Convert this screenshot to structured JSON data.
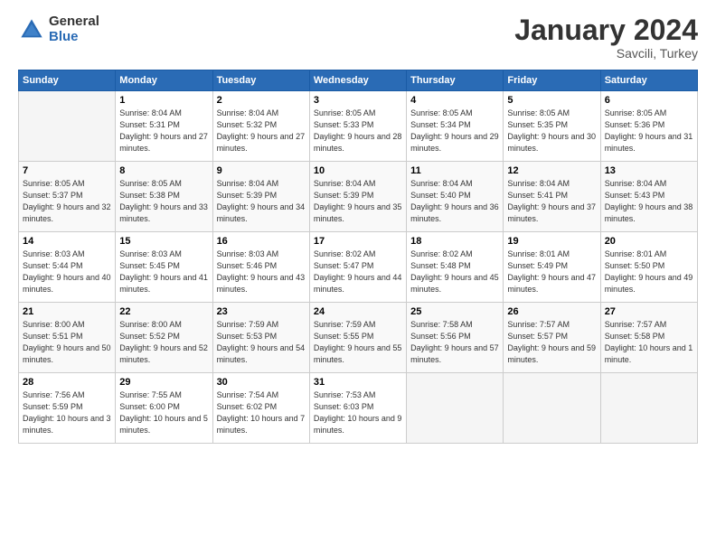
{
  "logo": {
    "general": "General",
    "blue": "Blue"
  },
  "header": {
    "month": "January 2024",
    "location": "Savcili, Turkey"
  },
  "weekdays": [
    "Sunday",
    "Monday",
    "Tuesday",
    "Wednesday",
    "Thursday",
    "Friday",
    "Saturday"
  ],
  "weeks": [
    [
      {
        "day": "",
        "empty": true
      },
      {
        "day": "1",
        "sunrise": "Sunrise: 8:04 AM",
        "sunset": "Sunset: 5:31 PM",
        "daylight": "Daylight: 9 hours and 27 minutes."
      },
      {
        "day": "2",
        "sunrise": "Sunrise: 8:04 AM",
        "sunset": "Sunset: 5:32 PM",
        "daylight": "Daylight: 9 hours and 27 minutes."
      },
      {
        "day": "3",
        "sunrise": "Sunrise: 8:05 AM",
        "sunset": "Sunset: 5:33 PM",
        "daylight": "Daylight: 9 hours and 28 minutes."
      },
      {
        "day": "4",
        "sunrise": "Sunrise: 8:05 AM",
        "sunset": "Sunset: 5:34 PM",
        "daylight": "Daylight: 9 hours and 29 minutes."
      },
      {
        "day": "5",
        "sunrise": "Sunrise: 8:05 AM",
        "sunset": "Sunset: 5:35 PM",
        "daylight": "Daylight: 9 hours and 30 minutes."
      },
      {
        "day": "6",
        "sunrise": "Sunrise: 8:05 AM",
        "sunset": "Sunset: 5:36 PM",
        "daylight": "Daylight: 9 hours and 31 minutes."
      }
    ],
    [
      {
        "day": "7",
        "sunrise": "Sunrise: 8:05 AM",
        "sunset": "Sunset: 5:37 PM",
        "daylight": "Daylight: 9 hours and 32 minutes."
      },
      {
        "day": "8",
        "sunrise": "Sunrise: 8:05 AM",
        "sunset": "Sunset: 5:38 PM",
        "daylight": "Daylight: 9 hours and 33 minutes."
      },
      {
        "day": "9",
        "sunrise": "Sunrise: 8:04 AM",
        "sunset": "Sunset: 5:39 PM",
        "daylight": "Daylight: 9 hours and 34 minutes."
      },
      {
        "day": "10",
        "sunrise": "Sunrise: 8:04 AM",
        "sunset": "Sunset: 5:39 PM",
        "daylight": "Daylight: 9 hours and 35 minutes."
      },
      {
        "day": "11",
        "sunrise": "Sunrise: 8:04 AM",
        "sunset": "Sunset: 5:40 PM",
        "daylight": "Daylight: 9 hours and 36 minutes."
      },
      {
        "day": "12",
        "sunrise": "Sunrise: 8:04 AM",
        "sunset": "Sunset: 5:41 PM",
        "daylight": "Daylight: 9 hours and 37 minutes."
      },
      {
        "day": "13",
        "sunrise": "Sunrise: 8:04 AM",
        "sunset": "Sunset: 5:43 PM",
        "daylight": "Daylight: 9 hours and 38 minutes."
      }
    ],
    [
      {
        "day": "14",
        "sunrise": "Sunrise: 8:03 AM",
        "sunset": "Sunset: 5:44 PM",
        "daylight": "Daylight: 9 hours and 40 minutes."
      },
      {
        "day": "15",
        "sunrise": "Sunrise: 8:03 AM",
        "sunset": "Sunset: 5:45 PM",
        "daylight": "Daylight: 9 hours and 41 minutes."
      },
      {
        "day": "16",
        "sunrise": "Sunrise: 8:03 AM",
        "sunset": "Sunset: 5:46 PM",
        "daylight": "Daylight: 9 hours and 43 minutes."
      },
      {
        "day": "17",
        "sunrise": "Sunrise: 8:02 AM",
        "sunset": "Sunset: 5:47 PM",
        "daylight": "Daylight: 9 hours and 44 minutes."
      },
      {
        "day": "18",
        "sunrise": "Sunrise: 8:02 AM",
        "sunset": "Sunset: 5:48 PM",
        "daylight": "Daylight: 9 hours and 45 minutes."
      },
      {
        "day": "19",
        "sunrise": "Sunrise: 8:01 AM",
        "sunset": "Sunset: 5:49 PM",
        "daylight": "Daylight: 9 hours and 47 minutes."
      },
      {
        "day": "20",
        "sunrise": "Sunrise: 8:01 AM",
        "sunset": "Sunset: 5:50 PM",
        "daylight": "Daylight: 9 hours and 49 minutes."
      }
    ],
    [
      {
        "day": "21",
        "sunrise": "Sunrise: 8:00 AM",
        "sunset": "Sunset: 5:51 PM",
        "daylight": "Daylight: 9 hours and 50 minutes."
      },
      {
        "day": "22",
        "sunrise": "Sunrise: 8:00 AM",
        "sunset": "Sunset: 5:52 PM",
        "daylight": "Daylight: 9 hours and 52 minutes."
      },
      {
        "day": "23",
        "sunrise": "Sunrise: 7:59 AM",
        "sunset": "Sunset: 5:53 PM",
        "daylight": "Daylight: 9 hours and 54 minutes."
      },
      {
        "day": "24",
        "sunrise": "Sunrise: 7:59 AM",
        "sunset": "Sunset: 5:55 PM",
        "daylight": "Daylight: 9 hours and 55 minutes."
      },
      {
        "day": "25",
        "sunrise": "Sunrise: 7:58 AM",
        "sunset": "Sunset: 5:56 PM",
        "daylight": "Daylight: 9 hours and 57 minutes."
      },
      {
        "day": "26",
        "sunrise": "Sunrise: 7:57 AM",
        "sunset": "Sunset: 5:57 PM",
        "daylight": "Daylight: 9 hours and 59 minutes."
      },
      {
        "day": "27",
        "sunrise": "Sunrise: 7:57 AM",
        "sunset": "Sunset: 5:58 PM",
        "daylight": "Daylight: 10 hours and 1 minute."
      }
    ],
    [
      {
        "day": "28",
        "sunrise": "Sunrise: 7:56 AM",
        "sunset": "Sunset: 5:59 PM",
        "daylight": "Daylight: 10 hours and 3 minutes."
      },
      {
        "day": "29",
        "sunrise": "Sunrise: 7:55 AM",
        "sunset": "Sunset: 6:00 PM",
        "daylight": "Daylight: 10 hours and 5 minutes."
      },
      {
        "day": "30",
        "sunrise": "Sunrise: 7:54 AM",
        "sunset": "Sunset: 6:02 PM",
        "daylight": "Daylight: 10 hours and 7 minutes."
      },
      {
        "day": "31",
        "sunrise": "Sunrise: 7:53 AM",
        "sunset": "Sunset: 6:03 PM",
        "daylight": "Daylight: 10 hours and 9 minutes."
      },
      {
        "day": "",
        "empty": true
      },
      {
        "day": "",
        "empty": true
      },
      {
        "day": "",
        "empty": true
      }
    ]
  ]
}
